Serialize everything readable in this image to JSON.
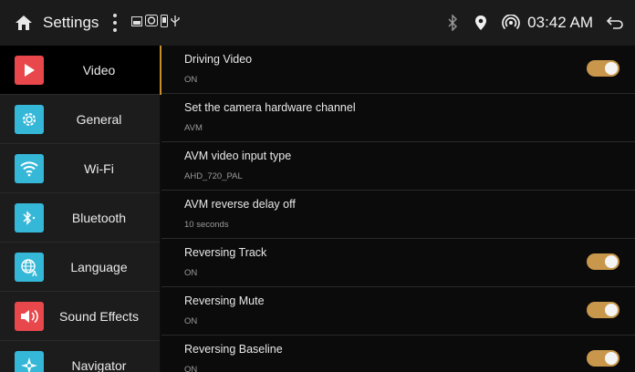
{
  "statusbar": {
    "title": "Settings",
    "time": "03:42 AM"
  },
  "sidebar": {
    "items": [
      {
        "label": "Video",
        "icon": "video-play-icon",
        "color": "#e8474b"
      },
      {
        "label": "General",
        "icon": "gear-icon",
        "color": "#35b7d8"
      },
      {
        "label": "Wi-Fi",
        "icon": "wifi-icon",
        "color": "#35b7d8"
      },
      {
        "label": "Bluetooth",
        "icon": "bluetooth-icon",
        "color": "#35b7d8"
      },
      {
        "label": "Language",
        "icon": "globe-icon",
        "color": "#35b7d8"
      },
      {
        "label": "Sound Effects",
        "icon": "speaker-icon",
        "color": "#e8474b"
      },
      {
        "label": "Navigator",
        "icon": "compass-icon",
        "color": "#35b7d8"
      }
    ]
  },
  "settings": [
    {
      "title": "Driving Video",
      "value": "ON",
      "toggle": true
    },
    {
      "title": "Set the camera hardware channel",
      "value": "AVM",
      "toggle": false
    },
    {
      "title": "AVM video input type",
      "value": "AHD_720_PAL",
      "toggle": false
    },
    {
      "title": "AVM reverse delay off",
      "value": "10 seconds",
      "toggle": false
    },
    {
      "title": "Reversing Track",
      "value": "ON",
      "toggle": true
    },
    {
      "title": "Reversing Mute",
      "value": "ON",
      "toggle": true
    },
    {
      "title": "Reversing Baseline",
      "value": "ON",
      "toggle": true
    }
  ],
  "colors": {
    "accent": "#c8974b",
    "red_icon": "#e8474b",
    "blue_icon": "#35b7d8"
  }
}
